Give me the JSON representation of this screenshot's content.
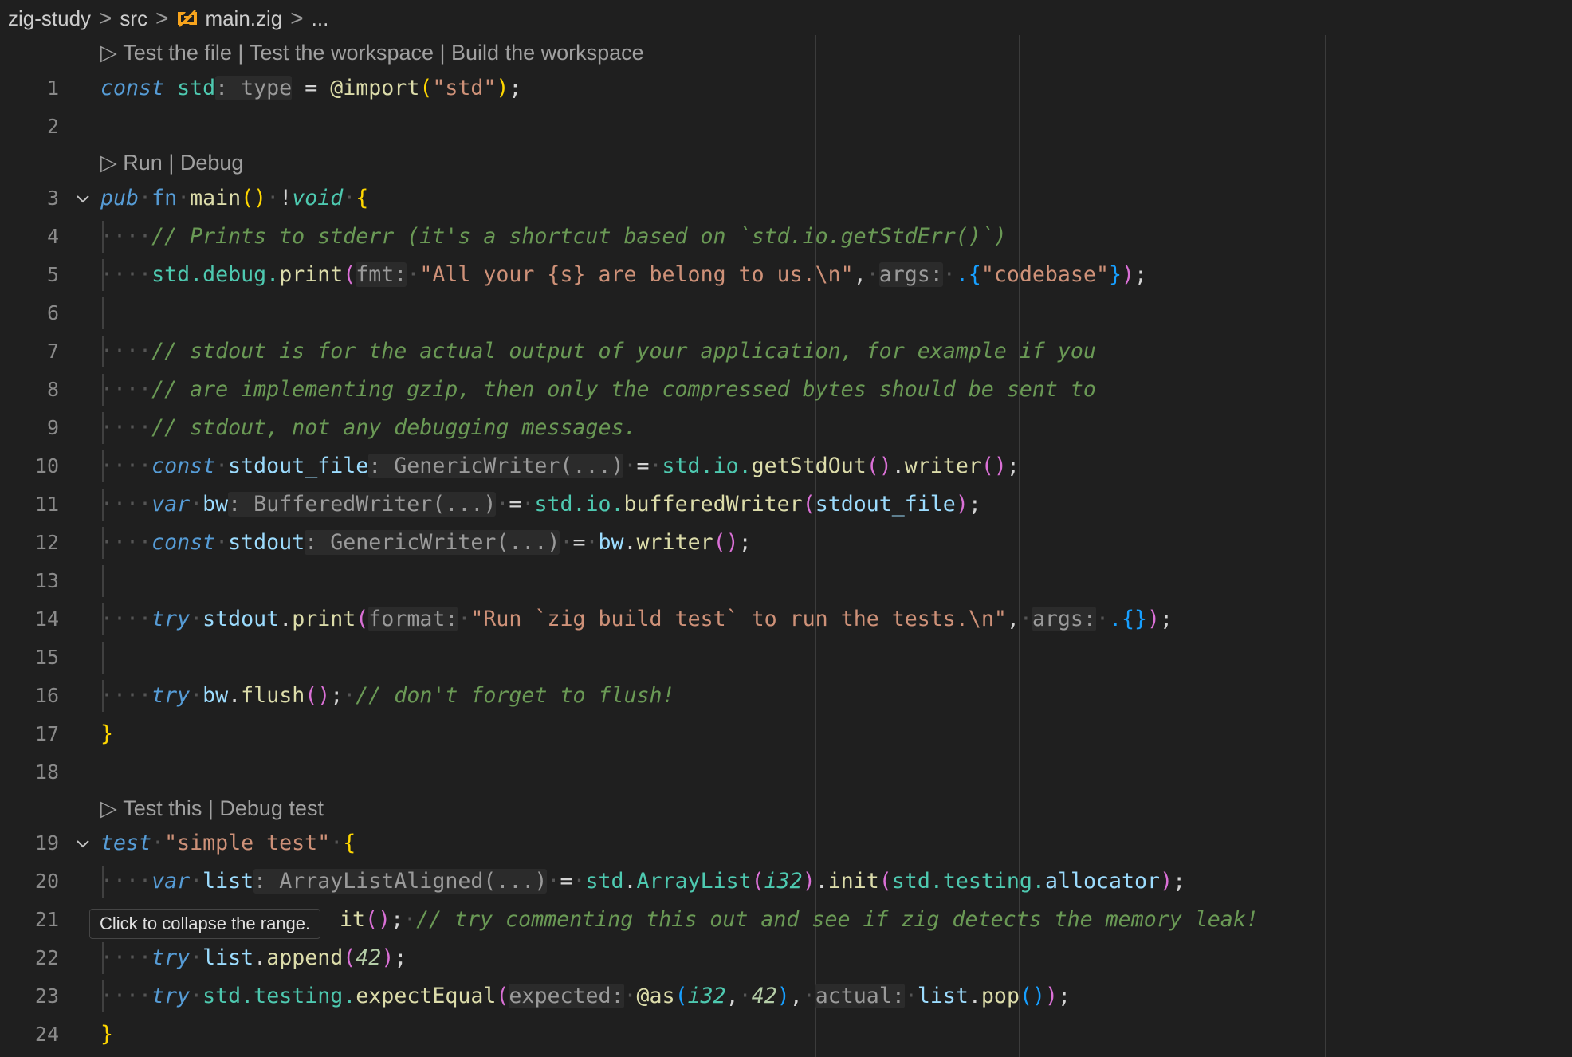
{
  "breadcrumb": {
    "items": [
      "zig-study",
      "src",
      "main.zig",
      "..."
    ],
    "separator": ">"
  },
  "codelens": {
    "top": {
      "arrow": "▷",
      "actions": [
        "Test the file",
        "Test the workspace",
        "Build the workspace"
      ],
      "sep": " | "
    },
    "main": {
      "arrow": "▷",
      "actions": [
        "Run",
        "Debug"
      ],
      "sep": " | "
    },
    "test": {
      "arrow": "▷",
      "actions": [
        "Test this",
        "Debug test"
      ],
      "sep": " | "
    }
  },
  "editor": {
    "line_numbers": [
      "1",
      "2",
      "3",
      "4",
      "5",
      "6",
      "7",
      "8",
      "9",
      "10",
      "11",
      "12",
      "13",
      "14",
      "15",
      "16",
      "17",
      "18",
      "19",
      "20",
      "21",
      "22",
      "23",
      "24"
    ],
    "lines": {
      "l1": [
        "const",
        "std",
        ": type",
        "=",
        "@import",
        "(",
        "\"std\"",
        ")",
        ";"
      ],
      "l3": [
        "pub",
        "fn",
        "main",
        "(",
        ")",
        "!",
        "void",
        "{"
      ],
      "l4": "// Prints to stderr (it's a shortcut based on `std.io.getStdErr()`)",
      "l5": [
        "std",
        ".debug.",
        "print",
        "(",
        "fmt:",
        "\"All your {s} are belong to us.\\n\"",
        ",",
        "args:",
        ".{",
        "\"codebase\"",
        "}",
        ")",
        ";"
      ],
      "l7": "// stdout is for the actual output of your application, for example if you",
      "l8": "// are implementing gzip, then only the compressed bytes should be sent to",
      "l9": "// stdout, not any debugging messages.",
      "l10": [
        "const",
        "stdout_file",
        ": GenericWriter(...)",
        "=",
        "std",
        ".io.",
        "getStdOut",
        "(",
        ")",
        ".",
        "writer",
        "(",
        ")",
        ";"
      ],
      "l11": [
        "var",
        "bw",
        ": BufferedWriter(...)",
        "=",
        "std",
        ".io.",
        "bufferedWriter",
        "(",
        "stdout_file",
        ")",
        ";"
      ],
      "l12": [
        "const",
        "stdout",
        ": GenericWriter(...)",
        "=",
        "bw",
        ".",
        "writer",
        "(",
        ")",
        ";"
      ],
      "l14": [
        "try",
        "stdout",
        ".",
        "print",
        "(",
        "format:",
        "\"Run `zig build test` to run the tests.\\n\"",
        ",",
        "args:",
        ".{",
        "}",
        ")",
        ";"
      ],
      "l16": [
        "try",
        "bw",
        ".",
        "flush",
        "(",
        ")",
        ";",
        "// don't forget to flush!"
      ],
      "l17": "}",
      "l19": [
        "test",
        "\"simple test\"",
        "{"
      ],
      "l20": [
        "var",
        "list",
        ": ArrayListAligned(...)",
        "=",
        "std",
        ".",
        "ArrayList",
        "(",
        "i32",
        ")",
        ".",
        "init",
        "(",
        "std",
        ".testing.",
        "allocator",
        ")",
        ";"
      ],
      "l21": [
        "it",
        "(",
        ")",
        ";",
        "// try commenting this out and see if zig detects the memory leak!"
      ],
      "l22": [
        "try",
        "list",
        ".",
        "append",
        "(",
        "42",
        ")",
        ";"
      ],
      "l23": [
        "try",
        "std",
        ".testing.",
        "expectEqual",
        "(",
        "expected:",
        "@as",
        "(",
        "i32",
        ",",
        "42",
        ")",
        ",",
        "actual:",
        "list",
        ".",
        "pop",
        "(",
        ")",
        ")",
        ";"
      ],
      "l24": "}"
    },
    "whitespace_marker": "···",
    "tooltip": "Click to collapse the range."
  },
  "colors": {
    "background": "#1f1f1f",
    "keyword": "#569cd6",
    "type": "#4ec9b0",
    "function": "#dcdcaa",
    "string": "#ce9178",
    "comment": "#6a9955",
    "bracket1": "#ffd700",
    "bracket2": "#da70d6",
    "bracket3": "#179fff"
  },
  "icons": {
    "file": "zig-file-icon",
    "fold": "chevron-down-icon",
    "run": "play-outline-icon"
  }
}
